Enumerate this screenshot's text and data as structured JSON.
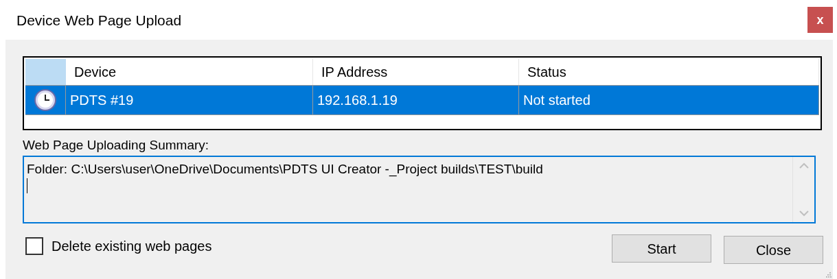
{
  "window": {
    "title": "Device Web Page Upload",
    "close": "x"
  },
  "table": {
    "columns": [
      "Device",
      "IP Address",
      "Status"
    ],
    "rows": [
      {
        "selected": true,
        "cells": [
          "PDTS #19",
          "192.168.1.19",
          "Not started"
        ]
      }
    ]
  },
  "summary": {
    "label": "Web Page Uploading Summary:",
    "value": "Folder: C:\\Users\\user\\OneDrive\\Documents\\PDTS UI Creator -_Project builds\\TEST\\build"
  },
  "delete_existing": {
    "label": "Delete existing web pages",
    "checked": false
  },
  "buttons": [
    "Start",
    "Close"
  ]
}
